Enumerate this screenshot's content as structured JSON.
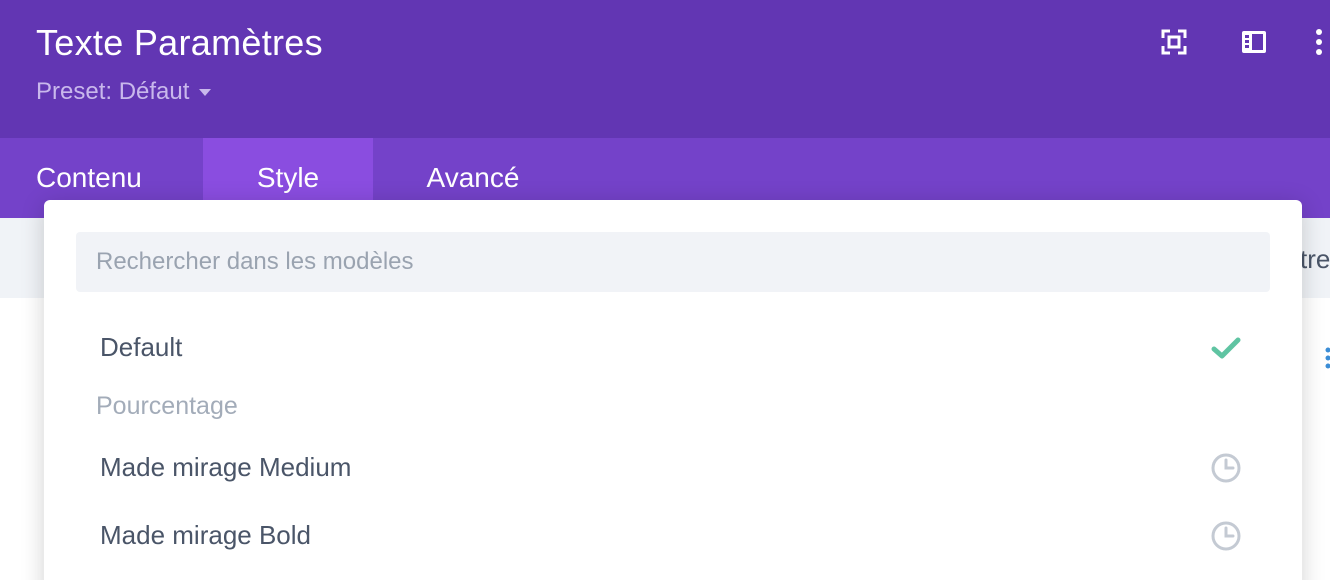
{
  "header": {
    "title": "Texte Paramètres",
    "preset_label": "Preset: Défaut",
    "icons": [
      "fullscreen-icon",
      "split-view-icon",
      "more-options-icon"
    ],
    "bg_color": "#6236b3"
  },
  "tabs": [
    {
      "label": "Contenu",
      "active": false
    },
    {
      "label": "Style",
      "active": true
    },
    {
      "label": "Avancé",
      "active": false
    }
  ],
  "background": {
    "partial_text": "tre"
  },
  "dropdown": {
    "search": {
      "placeholder": "Rechercher dans les modèles",
      "value": ""
    },
    "items": [
      {
        "label": "Default",
        "icon": "checkmark-icon",
        "selected": true
      },
      {
        "label": "Made mirage Medium",
        "icon": "clock-icon",
        "selected": false
      },
      {
        "label": "Made mirage Bold",
        "icon": "clock-icon",
        "selected": false
      }
    ],
    "group_label": "Pourcentage"
  },
  "colors": {
    "accent_purple": "#7442c9",
    "active_tab": "#8a4de0",
    "check_green": "#5fc4a2"
  }
}
